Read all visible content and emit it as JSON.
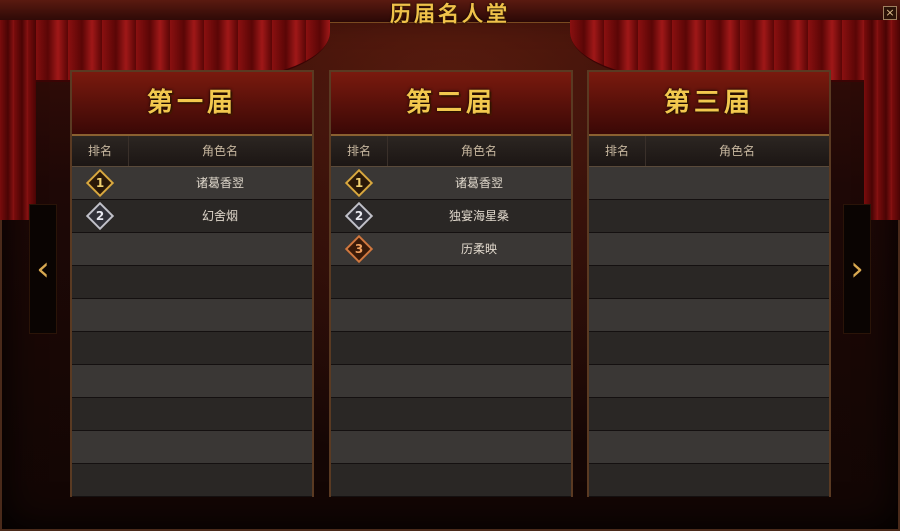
{
  "window": {
    "title": "历届名人堂",
    "close_label": "×"
  },
  "columns": [
    {
      "title": "第一届",
      "rank_header": "排名",
      "name_header": "角色名",
      "entries": [
        {
          "rank": "1",
          "name": "诸葛香翌"
        },
        {
          "rank": "2",
          "name": "幻舍烟"
        }
      ]
    },
    {
      "title": "第二届",
      "rank_header": "排名",
      "name_header": "角色名",
      "entries": [
        {
          "rank": "1",
          "name": "诸葛香翌"
        },
        {
          "rank": "2",
          "name": "独宴海星桑"
        },
        {
          "rank": "3",
          "name": "历柔映"
        }
      ]
    },
    {
      "title": "第三届",
      "rank_header": "排名",
      "name_header": "角色名",
      "entries": []
    }
  ],
  "nav": {
    "prev_icon": "chevron-left-icon",
    "next_icon": "chevron-right-icon",
    "prev_glyph": "‹",
    "next_glyph": "›"
  },
  "colors": {
    "gold": "#f0c24a",
    "medal_gold": "#d8a840",
    "medal_silver": "#c0c0c8",
    "medal_bronze": "#d07840"
  }
}
